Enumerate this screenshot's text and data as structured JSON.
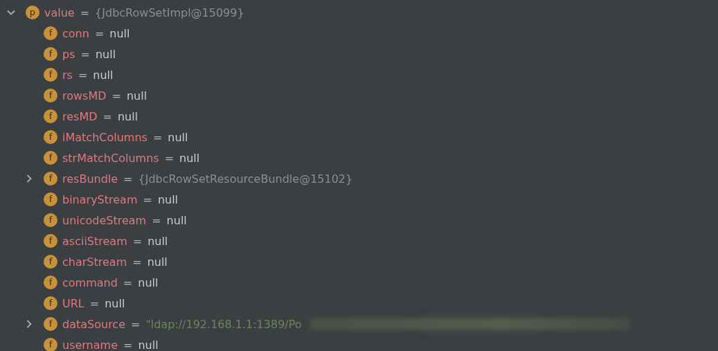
{
  "variables": [
    {
      "icon": "p",
      "name": "value",
      "sep": "=",
      "value": "{JdbcRowSetImpl@15099}",
      "kind": "object",
      "expanded": true,
      "children": [
        {
          "icon": "f",
          "name": "conn",
          "sep": "=",
          "value": "null",
          "kind": "null"
        },
        {
          "icon": "f",
          "name": "ps",
          "sep": "=",
          "value": "null",
          "kind": "null"
        },
        {
          "icon": "f",
          "name": "rs",
          "sep": "=",
          "value": "null",
          "kind": "null"
        },
        {
          "icon": "f",
          "name": "rowsMD",
          "sep": "=",
          "value": "null",
          "kind": "null"
        },
        {
          "icon": "f",
          "name": "resMD",
          "sep": "=",
          "value": "null",
          "kind": "null"
        },
        {
          "icon": "f",
          "name": "iMatchColumns",
          "sep": "=",
          "value": "null",
          "kind": "null"
        },
        {
          "icon": "f",
          "name": "strMatchColumns",
          "sep": "=",
          "value": "null",
          "kind": "null"
        },
        {
          "icon": "f",
          "name": "resBundle",
          "sep": "=",
          "value": "{JdbcRowSetResourceBundle@15102}",
          "kind": "object",
          "expanded": false
        },
        {
          "icon": "f",
          "name": "binaryStream",
          "sep": "=",
          "value": "null",
          "kind": "null"
        },
        {
          "icon": "f",
          "name": "unicodeStream",
          "sep": "=",
          "value": "null",
          "kind": "null"
        },
        {
          "icon": "f",
          "name": "asciiStream",
          "sep": "=",
          "value": "null",
          "kind": "null"
        },
        {
          "icon": "f",
          "name": "charStream",
          "sep": "=",
          "value": "null",
          "kind": "null"
        },
        {
          "icon": "f",
          "name": "command",
          "sep": "=",
          "value": "null",
          "kind": "null"
        },
        {
          "icon": "f",
          "name": "URL",
          "sep": "=",
          "value": "null",
          "kind": "null"
        },
        {
          "icon": "f",
          "name": "dataSource",
          "sep": "=",
          "value": "\"ldap://192.168.1.1:1389/Po",
          "kind": "string",
          "expanded": false,
          "redacted": true
        },
        {
          "icon": "f",
          "name": "username",
          "sep": "=",
          "value": "null",
          "kind": "null"
        }
      ]
    }
  ]
}
